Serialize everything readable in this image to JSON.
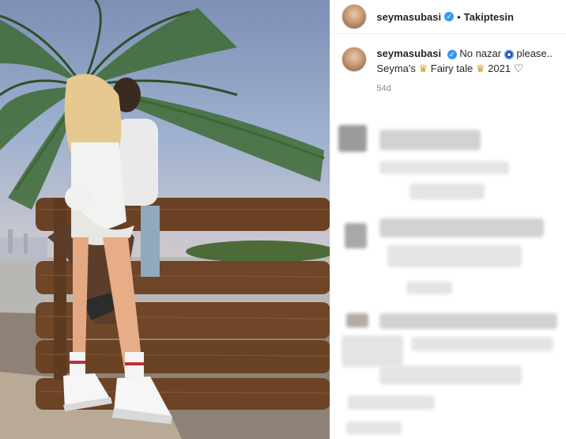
{
  "header": {
    "username": "seymasubasi",
    "follow_status": "Takiptesin"
  },
  "caption": {
    "username": "seymasubasi",
    "line1_a": "No nazar",
    "line1_b": "please..",
    "line2_a": "Seyma's",
    "line2_b": "Fairy tale",
    "line2_c": "2021",
    "heart": "♡",
    "crown1": "♛",
    "crown2": "♛"
  },
  "timestamp": "54d",
  "icons": {
    "verified": "verified-badge-icon",
    "eye": "nazar-eye-icon",
    "heart": "heart-icon"
  },
  "colors": {
    "accent": "#3897f0",
    "text": "#262626",
    "muted": "#8e8e8e"
  }
}
